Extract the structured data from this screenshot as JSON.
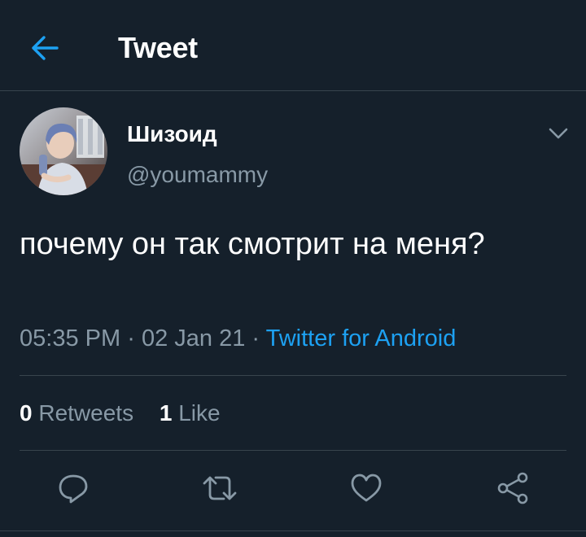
{
  "header": {
    "title": "Tweet",
    "back_icon": "arrow-left-icon"
  },
  "author": {
    "display_name": "Шизоид",
    "handle": "@youmammy"
  },
  "tweet": {
    "text": "почему он так смотрит на меня?",
    "time": "05:35 PM",
    "separator": "·",
    "date": "02 Jan 21",
    "source": "Twitter for Android"
  },
  "stats": {
    "retweets_count": "0",
    "retweets_label": "Retweets",
    "likes_count": "1",
    "likes_label": "Like"
  },
  "actions": {
    "reply_icon": "reply-icon",
    "retweet_icon": "retweet-icon",
    "like_icon": "heart-icon",
    "share_icon": "share-icon"
  },
  "colors": {
    "background": "#15202b",
    "accent": "#1da1f2",
    "secondary_text": "#8899a6",
    "border": "#38444d"
  }
}
